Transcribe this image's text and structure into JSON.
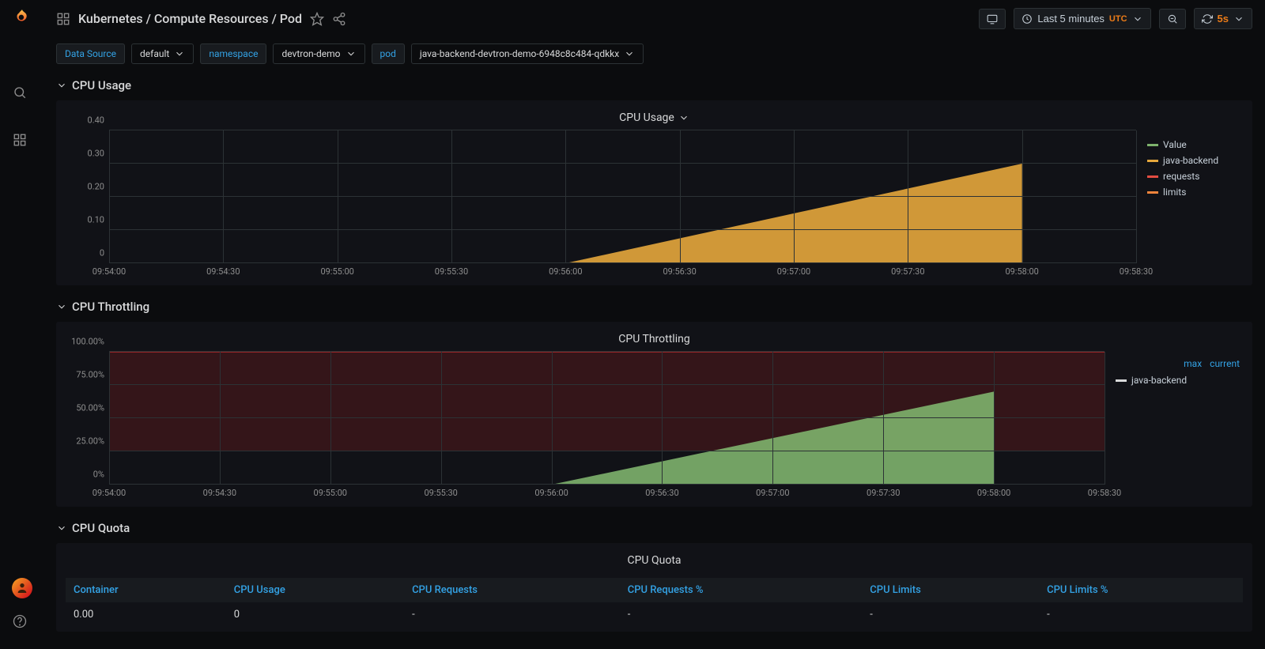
{
  "breadcrumbs": "Kubernetes / Compute Resources / Pod",
  "toolbar": {
    "time_label": "Last 5 minutes",
    "time_zone": "UTC",
    "refresh_interval": "5s"
  },
  "filters": {
    "data_source_label": "Data Source",
    "data_source_value": "default",
    "namespace_label": "namespace",
    "namespace_value": "devtron-demo",
    "pod_label": "pod",
    "pod_value": "java-backend-devtron-demo-6948c8c484-qdkkx"
  },
  "rows": {
    "cpu_usage": "CPU Usage",
    "cpu_throttling": "CPU Throttling",
    "cpu_quota": "CPU Quota"
  },
  "panels": {
    "cpu_usage_title": "CPU Usage",
    "cpu_throttling_title": "CPU Throttling",
    "cpu_quota_title": "CPU Quota"
  },
  "legend1": {
    "value": "Value",
    "java": "java-backend",
    "req": "requests",
    "lim": "limits"
  },
  "legend2": {
    "max": "max",
    "current": "current",
    "java": "java-backend"
  },
  "table": {
    "headers": [
      "Container",
      "CPU Usage",
      "CPU Requests",
      "CPU Requests %",
      "CPU Limits",
      "CPU Limits %"
    ],
    "row": [
      "0.00",
      "0",
      "-",
      "-",
      "-",
      "-"
    ]
  },
  "chart_data": [
    {
      "type": "area",
      "title": "CPU Usage",
      "xlabel": "",
      "ylabel": "",
      "ylim": [
        0,
        0.4
      ],
      "yticks": [
        0,
        0.1,
        0.2,
        0.3,
        0.4
      ],
      "x_categories": [
        "09:54:00",
        "09:54:30",
        "09:55:00",
        "09:55:30",
        "09:56:00",
        "09:56:30",
        "09:57:00",
        "09:57:30",
        "09:58:00",
        "09:58:30"
      ],
      "series": [
        {
          "name": "java-backend",
          "color": "#e5a73c",
          "x": [
            "09:56:00",
            "09:58:00"
          ],
          "values": [
            0.0,
            0.3
          ]
        }
      ],
      "legend": [
        "Value",
        "java-backend",
        "requests",
        "limits"
      ]
    },
    {
      "type": "area",
      "title": "CPU Throttling",
      "xlabel": "",
      "ylabel": "",
      "ylim": [
        0,
        100
      ],
      "yticks": [
        "0%",
        "25.00%",
        "50.00%",
        "75.00%",
        "100.00%"
      ],
      "x_categories": [
        "09:54:00",
        "09:54:30",
        "09:55:00",
        "09:55:30",
        "09:56:00",
        "09:56:30",
        "09:57:00",
        "09:57:30",
        "09:58:00",
        "09:58:30"
      ],
      "series": [
        {
          "name": "java-backend",
          "color": "#7eb26d",
          "x": [
            "09:56:00",
            "09:58:00"
          ],
          "values": [
            0,
            70
          ]
        }
      ],
      "threshold_band": {
        "from": 25,
        "to": 100,
        "color": "rgba(160,30,30,0.25)"
      },
      "legend": [
        "java-backend"
      ],
      "legend_columns": [
        "max",
        "current"
      ]
    }
  ]
}
